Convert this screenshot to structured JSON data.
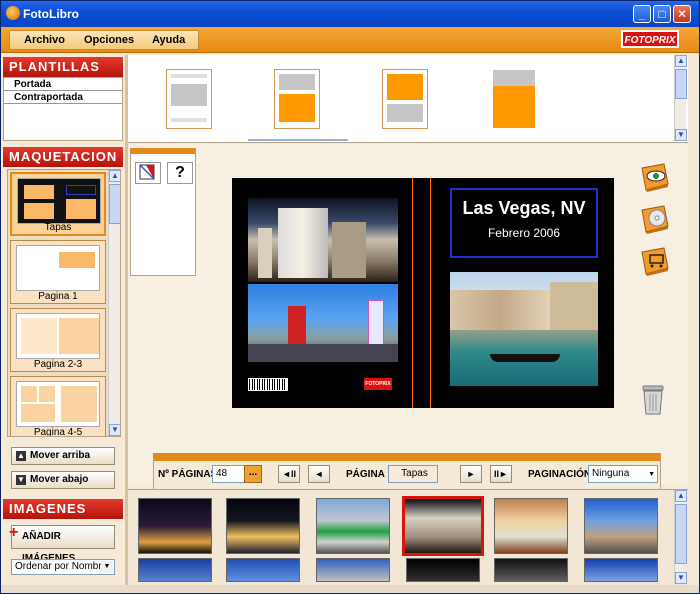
{
  "window": {
    "title": "FotoLibro",
    "minimize_glyph": "_",
    "maximize_glyph": "□",
    "close_glyph": "✕"
  },
  "menu": {
    "items": [
      "Archivo",
      "Opciones",
      "Ayuda"
    ],
    "brand": "FOTOPRIX"
  },
  "plantillas": {
    "header": "PLANTILLAS",
    "items": [
      "Portada",
      "Contraportada"
    ]
  },
  "maquetacion": {
    "header": "MAQUETACION",
    "pages": [
      "Tapas",
      "Pagina 1",
      "Pagina 2-3",
      "Pagina 4-5"
    ],
    "selected": "Tapas",
    "move_up": "Mover arriba",
    "move_down": "Mover abajo"
  },
  "imagenes": {
    "header": "IMAGENES",
    "add_button": "AÑADIR IMÁGENES",
    "sort_value": "Ordenar por Nombre"
  },
  "tools": {
    "help_glyph": "?"
  },
  "book": {
    "title": "Las Vegas, NV",
    "subtitle": "Febrero 2006",
    "back_logo": "FOTOPRIX"
  },
  "pagination": {
    "pages_label": "Nº PÁGINAS",
    "pages_value": "48",
    "dots": "...",
    "first_glyph": "◄II",
    "prev_glyph": "◄",
    "page_label": "PÁGINA",
    "page_value": "Tapas",
    "next_glyph": "►",
    "last_glyph": "II►",
    "numbering_label": "PAGINACIÓN",
    "numbering_value": "Ninguna"
  },
  "colors": {
    "accent_orange": "#e38a1a",
    "header_red": "#c41e12",
    "selection_red": "#d9130e",
    "title_blue": "#1f2fd0"
  }
}
